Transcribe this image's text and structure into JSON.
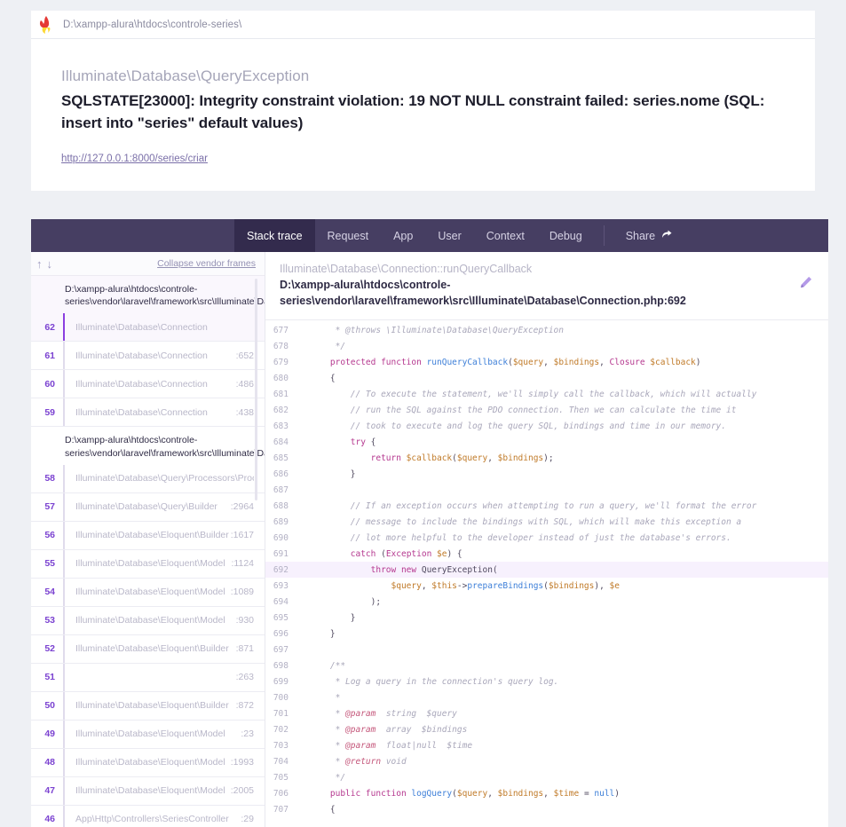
{
  "urlbar": {
    "icon": "flame-icon",
    "path": "D:\\xampp-alura\\htdocs\\controle-series\\"
  },
  "exception": {
    "class": "Illuminate\\Database\\QueryException",
    "message": "SQLSTATE[23000]: Integrity constraint violation: 19 NOT NULL constraint failed: series.nome (SQL: insert into \"series\" default values)",
    "url": "http://127.0.0.1:8000/series/criar"
  },
  "nav": {
    "tabs": [
      {
        "label": "Stack trace",
        "active": true
      },
      {
        "label": "Request",
        "active": false
      },
      {
        "label": "App",
        "active": false
      },
      {
        "label": "User",
        "active": false
      },
      {
        "label": "Context",
        "active": false
      },
      {
        "label": "Debug",
        "active": false
      }
    ],
    "share_label": "Share",
    "share_icon": "share-arrow-icon"
  },
  "frames_panel": {
    "up_icon": "arrow-up-icon",
    "down_icon": "arrow-down-icon",
    "collapse_label": "Collapse vendor frames",
    "groups": [
      {
        "path_line1": "D:\\xampp-alura\\htdocs\\controle-",
        "path_line2": "series\\vendor\\laravel\\framework\\src\\Illuminate\\Data",
        "selected": true,
        "rows": [
          {
            "num": "62",
            "cls": "Illuminate\\Database\\Connection",
            "line": "",
            "selected": true
          },
          {
            "num": "61",
            "cls": "Illuminate\\Database\\Connection",
            "line": ":652",
            "selected": false
          },
          {
            "num": "60",
            "cls": "Illuminate\\Database\\Connection",
            "line": ":486",
            "selected": false
          },
          {
            "num": "59",
            "cls": "Illuminate\\Database\\Connection",
            "line": ":438",
            "selected": false
          }
        ]
      },
      {
        "path_line1": "D:\\xampp-alura\\htdocs\\controle-",
        "path_line2": "series\\vendor\\laravel\\framework\\src\\Illuminate\\Data",
        "selected": false,
        "rows": [
          {
            "num": "58",
            "cls": "Illuminate\\Database\\Query\\Processors\\Processor",
            "line": "",
            "selected": false
          },
          {
            "num": "57",
            "cls": "Illuminate\\Database\\Query\\Builder",
            "line": ":2964",
            "selected": false
          },
          {
            "num": "56",
            "cls": "Illuminate\\Database\\Eloquent\\Builder",
            "line": ":1617",
            "selected": false
          },
          {
            "num": "55",
            "cls": "Illuminate\\Database\\Eloquent\\Model",
            "line": ":1124",
            "selected": false
          },
          {
            "num": "54",
            "cls": "Illuminate\\Database\\Eloquent\\Model",
            "line": ":1089",
            "selected": false
          },
          {
            "num": "53",
            "cls": "Illuminate\\Database\\Eloquent\\Model",
            "line": ":930",
            "selected": false
          },
          {
            "num": "52",
            "cls": "Illuminate\\Database\\Eloquent\\Builder",
            "line": ":871",
            "selected": false
          },
          {
            "num": "51",
            "cls": "",
            "line": ":263",
            "selected": false
          },
          {
            "num": "50",
            "cls": "Illuminate\\Database\\Eloquent\\Builder",
            "line": ":872",
            "selected": false
          },
          {
            "num": "49",
            "cls": "Illuminate\\Database\\Eloquent\\Model",
            "line": ":23",
            "selected": false
          },
          {
            "num": "48",
            "cls": "Illuminate\\Database\\Eloquent\\Model",
            "line": ":1993",
            "selected": false
          },
          {
            "num": "47",
            "cls": "Illuminate\\Database\\Eloquent\\Model",
            "line": ":2005",
            "selected": false
          },
          {
            "num": "46",
            "cls": "App\\Http\\Controllers\\SeriesController",
            "line": ":29",
            "selected": false
          }
        ]
      }
    ]
  },
  "code_panel": {
    "header_class": "Illuminate\\Database\\Connection::runQueryCallback",
    "header_path_line1": "D:\\xampp-alura\\htdocs\\controle-",
    "header_path_line2": "series\\vendor\\laravel\\framework\\src\\Illuminate\\Database\\Connection.php:692",
    "edit_icon": "pencil-icon",
    "highlight_line": "692",
    "lines": [
      {
        "n": "677",
        "tokens": [
          {
            "t": "doc",
            "v": "     * @throws \\Illuminate\\Database\\QueryException"
          }
        ]
      },
      {
        "n": "678",
        "tokens": [
          {
            "t": "doc",
            "v": "     */"
          }
        ]
      },
      {
        "n": "679",
        "tokens": [
          {
            "t": "kw",
            "v": "    protected function "
          },
          {
            "t": "fn",
            "v": "runQueryCallback"
          },
          {
            "t": "plain",
            "v": "("
          },
          {
            "t": "var",
            "v": "$query"
          },
          {
            "t": "plain",
            "v": ", "
          },
          {
            "t": "var",
            "v": "$bindings"
          },
          {
            "t": "plain",
            "v": ", "
          },
          {
            "t": "cls",
            "v": "Closure "
          },
          {
            "t": "var",
            "v": "$callback"
          },
          {
            "t": "plain",
            "v": ")"
          }
        ]
      },
      {
        "n": "680",
        "tokens": [
          {
            "t": "plain",
            "v": "    {"
          }
        ]
      },
      {
        "n": "681",
        "tokens": [
          {
            "t": "com",
            "v": "        // To execute the statement, we'll simply call the callback, which will actually"
          }
        ]
      },
      {
        "n": "682",
        "tokens": [
          {
            "t": "com",
            "v": "        // run the SQL against the PDO connection. Then we can calculate the time it"
          }
        ]
      },
      {
        "n": "683",
        "tokens": [
          {
            "t": "com",
            "v": "        // took to execute and log the query SQL, bindings and time in our memory."
          }
        ]
      },
      {
        "n": "684",
        "tokens": [
          {
            "t": "kw",
            "v": "        try "
          },
          {
            "t": "plain",
            "v": "{"
          }
        ]
      },
      {
        "n": "685",
        "tokens": [
          {
            "t": "kw",
            "v": "            return "
          },
          {
            "t": "var",
            "v": "$callback"
          },
          {
            "t": "plain",
            "v": "("
          },
          {
            "t": "var",
            "v": "$query"
          },
          {
            "t": "plain",
            "v": ", "
          },
          {
            "t": "var",
            "v": "$bindings"
          },
          {
            "t": "plain",
            "v": ");"
          }
        ]
      },
      {
        "n": "686",
        "tokens": [
          {
            "t": "plain",
            "v": "        }"
          }
        ]
      },
      {
        "n": "687",
        "tokens": [
          {
            "t": "plain",
            "v": ""
          }
        ]
      },
      {
        "n": "688",
        "tokens": [
          {
            "t": "com",
            "v": "        // If an exception occurs when attempting to run a query, we'll format the error"
          }
        ]
      },
      {
        "n": "689",
        "tokens": [
          {
            "t": "com",
            "v": "        // message to include the bindings with SQL, which will make this exception a"
          }
        ]
      },
      {
        "n": "690",
        "tokens": [
          {
            "t": "com",
            "v": "        // lot more helpful to the developer instead of just the database's errors."
          }
        ]
      },
      {
        "n": "691",
        "tokens": [
          {
            "t": "kw",
            "v": "        catch "
          },
          {
            "t": "plain",
            "v": "("
          },
          {
            "t": "cls",
            "v": "Exception "
          },
          {
            "t": "var",
            "v": "$e"
          },
          {
            "t": "plain",
            "v": ") {"
          }
        ]
      },
      {
        "n": "692",
        "tokens": [
          {
            "t": "kw",
            "v": "            throw new "
          },
          {
            "t": "plain",
            "v": "QueryException("
          }
        ]
      },
      {
        "n": "693",
        "tokens": [
          {
            "t": "var",
            "v": "                $query"
          },
          {
            "t": "plain",
            "v": ", "
          },
          {
            "t": "var",
            "v": "$this"
          },
          {
            "t": "plain",
            "v": "->"
          },
          {
            "t": "fn",
            "v": "prepareBindings"
          },
          {
            "t": "plain",
            "v": "("
          },
          {
            "t": "var",
            "v": "$bindings"
          },
          {
            "t": "plain",
            "v": "), "
          },
          {
            "t": "var",
            "v": "$e"
          }
        ]
      },
      {
        "n": "694",
        "tokens": [
          {
            "t": "plain",
            "v": "            );"
          }
        ]
      },
      {
        "n": "695",
        "tokens": [
          {
            "t": "plain",
            "v": "        }"
          }
        ]
      },
      {
        "n": "696",
        "tokens": [
          {
            "t": "plain",
            "v": "    }"
          }
        ]
      },
      {
        "n": "697",
        "tokens": [
          {
            "t": "plain",
            "v": ""
          }
        ]
      },
      {
        "n": "698",
        "tokens": [
          {
            "t": "doc",
            "v": "    /**"
          }
        ]
      },
      {
        "n": "699",
        "tokens": [
          {
            "t": "doc",
            "v": "     * Log a query in the connection's query log."
          }
        ]
      },
      {
        "n": "700",
        "tokens": [
          {
            "t": "doc",
            "v": "     *"
          }
        ]
      },
      {
        "n": "701",
        "tokens": [
          {
            "t": "doc",
            "v": "     * "
          },
          {
            "t": "tag",
            "v": "@param"
          },
          {
            "t": "doc",
            "v": "  string  $query"
          }
        ]
      },
      {
        "n": "702",
        "tokens": [
          {
            "t": "doc",
            "v": "     * "
          },
          {
            "t": "tag",
            "v": "@param"
          },
          {
            "t": "doc",
            "v": "  array  $bindings"
          }
        ]
      },
      {
        "n": "703",
        "tokens": [
          {
            "t": "doc",
            "v": "     * "
          },
          {
            "t": "tag",
            "v": "@param"
          },
          {
            "t": "doc",
            "v": "  float|null  $time"
          }
        ]
      },
      {
        "n": "704",
        "tokens": [
          {
            "t": "doc",
            "v": "     * "
          },
          {
            "t": "tag",
            "v": "@return"
          },
          {
            "t": "doc",
            "v": " void"
          }
        ]
      },
      {
        "n": "705",
        "tokens": [
          {
            "t": "doc",
            "v": "     */"
          }
        ]
      },
      {
        "n": "706",
        "tokens": [
          {
            "t": "kw",
            "v": "    public function "
          },
          {
            "t": "fn",
            "v": "logQuery"
          },
          {
            "t": "plain",
            "v": "("
          },
          {
            "t": "var",
            "v": "$query"
          },
          {
            "t": "plain",
            "v": ", "
          },
          {
            "t": "var",
            "v": "$bindings"
          },
          {
            "t": "plain",
            "v": ", "
          },
          {
            "t": "var",
            "v": "$time"
          },
          {
            "t": "plain",
            "v": " = "
          },
          {
            "t": "null",
            "v": "null"
          },
          {
            "t": "plain",
            "v": ")"
          }
        ]
      },
      {
        "n": "707",
        "tokens": [
          {
            "t": "plain",
            "v": "    {"
          }
        ]
      }
    ]
  },
  "colors": {
    "page_bg": "#eef0f4",
    "navbar_bg": "#463e62",
    "navbar_active_bg": "#332b4d",
    "accent_purple": "#8b3fe0",
    "frame_number": "#7b42d1",
    "highlight_row": "#f7f1fd"
  }
}
